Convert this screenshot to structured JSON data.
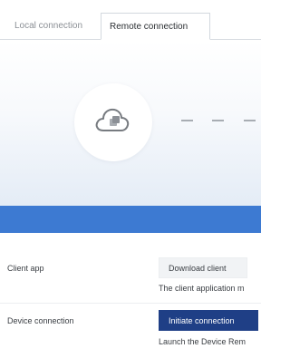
{
  "tabs": {
    "local": "Local connection",
    "remote": "Remote connection"
  },
  "illustration": {
    "icon": "cloud-icon",
    "connector": "dashed-line"
  },
  "colors": {
    "accent_band": "#3d7ad2",
    "primary_button": "#1f3f86",
    "secondary_button": "#f1f3f5"
  },
  "client_app": {
    "label": "Client app",
    "button": "Download client",
    "description": "The client application m"
  },
  "device_connection": {
    "label": "Device connection",
    "button": "Initiate connection",
    "description": "Launch the Device Rem"
  }
}
